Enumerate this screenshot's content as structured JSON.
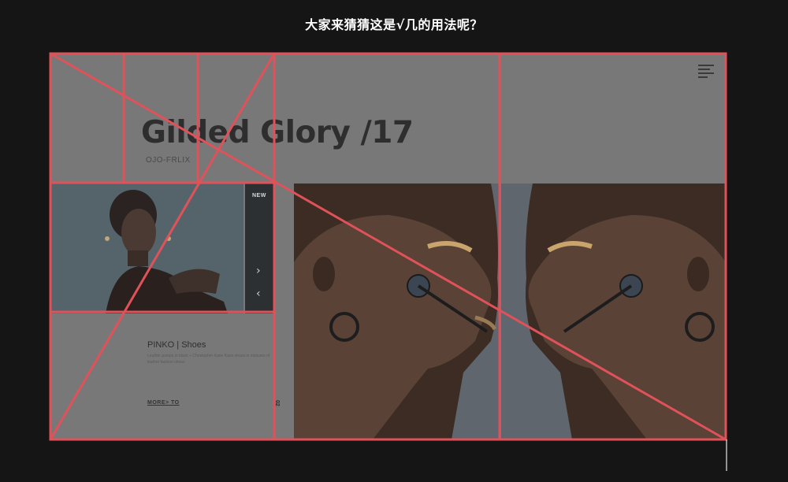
{
  "page": {
    "caption": "大家来猜猜这是√几的用法呢？"
  },
  "hero": {
    "title": "Gilded Glory /17",
    "subtitle": "OJO-FRLIX"
  },
  "thumbnail": {
    "badge": "NEW",
    "next_arrow": "›",
    "prev_arrow": "‹"
  },
  "card": {
    "title": "PINKO | Shoes",
    "description": "Leather pumps in black + Christopher Kane Kane shoes in mixtures of leather fashion shoes",
    "link": "MORE> TO",
    "page_number": "02"
  },
  "colors": {
    "guide_lines": "#e0525a",
    "page_background": "#151515",
    "canvas_gray": "#787878"
  },
  "icons": [
    "menu-icon",
    "chevron-right-icon",
    "chevron-left-icon"
  ]
}
